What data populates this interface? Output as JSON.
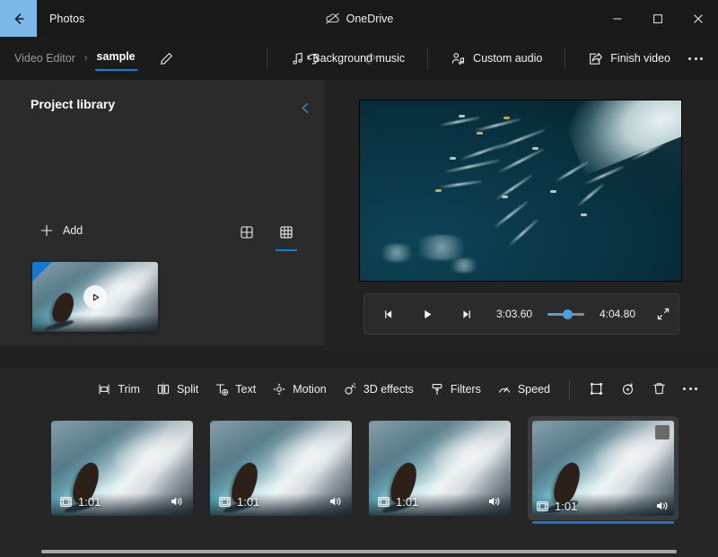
{
  "window": {
    "back_icon": "back-arrow-icon",
    "app_title": "Photos",
    "status_label": "OneDrive",
    "status_icon": "onedrive-offline-icon",
    "minimize": "minimize-icon",
    "maximize": "maximize-icon",
    "close": "close-icon"
  },
  "command_bar": {
    "breadcrumb_root": "Video Editor",
    "breadcrumb_separator": "›",
    "breadcrumb_current": "sample",
    "rename_icon": "pencil-icon",
    "undo_icon": "undo-icon",
    "redo_icon": "redo-icon",
    "actions": [
      {
        "label": "Background music",
        "icon": "music-note-icon"
      },
      {
        "label": "Custom audio",
        "icon": "person-audio-icon"
      },
      {
        "label": "Finish video",
        "icon": "share-export-icon"
      }
    ],
    "overflow_icon": "more-ellipsis-icon"
  },
  "library": {
    "title": "Project library",
    "collapse_icon": "chevron-left-icon",
    "add_label": "Add",
    "add_icon": "plus-icon",
    "views": [
      {
        "name": "grid-view-large",
        "icon": "grid-2x2-icon",
        "selected": false
      },
      {
        "name": "grid-view-small",
        "icon": "grid-3x3-icon",
        "selected": true
      }
    ],
    "items": [
      {
        "name": "surf-video-thumbnail",
        "play_icon": "play-triangle-icon"
      }
    ]
  },
  "preview": {
    "alt": "aerial view of surfers paddling in dark teal ocean water"
  },
  "player": {
    "prev_frame_icon": "previous-frame-icon",
    "play_icon": "play-icon",
    "next_frame_icon": "next-frame-icon",
    "current_time": "3:03.60",
    "total_time": "4:04.80",
    "progress_percent": 56,
    "fullscreen_icon": "expand-fullscreen-icon"
  },
  "edit_toolbar": {
    "tools": [
      {
        "label": "Trim",
        "icon": "trim-icon"
      },
      {
        "label": "Split",
        "icon": "split-icon"
      },
      {
        "label": "Text",
        "icon": "text-add-icon"
      },
      {
        "label": "Motion",
        "icon": "motion-icon"
      },
      {
        "label": "3D effects",
        "icon": "3d-effects-icon"
      },
      {
        "label": "Filters",
        "icon": "filters-icon"
      },
      {
        "label": "Speed",
        "icon": "speed-icon"
      }
    ],
    "right_tools": [
      {
        "name": "crop-aspect-button",
        "icon": "crop-frame-icon"
      },
      {
        "name": "rotate-button",
        "icon": "rotate-icon"
      },
      {
        "name": "delete-button",
        "icon": "trash-icon"
      },
      {
        "name": "more-button",
        "icon": "more-ellipsis-icon"
      }
    ]
  },
  "storyboard": {
    "clips": [
      {
        "duration": "1:01",
        "film_icon": "film-strip-icon",
        "volume_icon": "volume-icon",
        "selected": false
      },
      {
        "duration": "1:01",
        "film_icon": "film-strip-icon",
        "volume_icon": "volume-icon",
        "selected": false
      },
      {
        "duration": "1:01",
        "film_icon": "film-strip-icon",
        "volume_icon": "volume-icon",
        "selected": false
      },
      {
        "duration": "1:01",
        "film_icon": "film-strip-icon",
        "volume_icon": "volume-icon",
        "selected": true
      }
    ],
    "scrollbar": "horizontal-scrollbar"
  },
  "colors": {
    "accent": "#0a84d8",
    "back_button": "#79b8e8",
    "slider": "#4aa3e0",
    "window_bg": "#202020",
    "panel_bg": "#2b2b2b",
    "timeline_bg": "#262626"
  }
}
